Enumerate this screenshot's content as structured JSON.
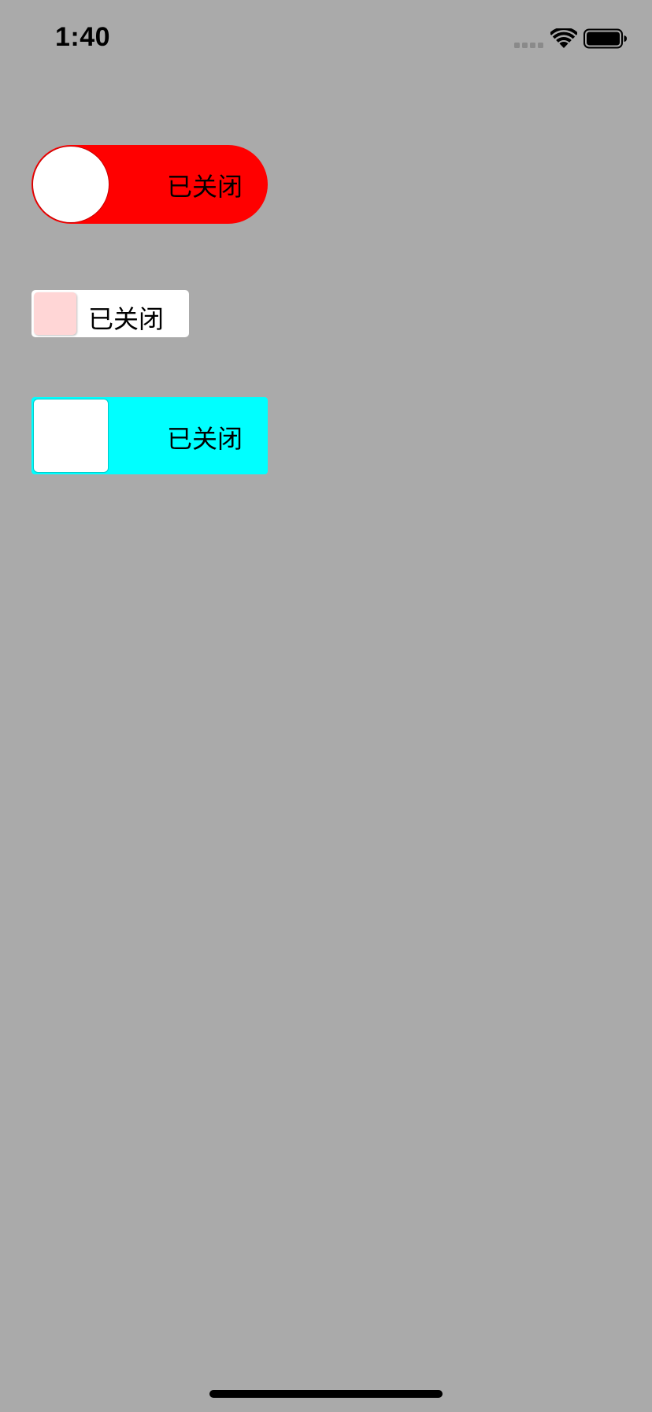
{
  "status_bar": {
    "time": "1:40",
    "icons": [
      "signal-icon",
      "wifi-icon",
      "battery-icon"
    ]
  },
  "toggles": [
    {
      "label": "已关闭",
      "state": "off",
      "track_color": "#ff0000",
      "knob_color": "#ffffff",
      "shape": "pill"
    },
    {
      "label": "已关闭",
      "state": "off",
      "track_color": "#ffffff",
      "knob_color": "#ffd6d6",
      "shape": "rounded-rect"
    },
    {
      "label": "已关闭",
      "state": "off",
      "track_color": "#00ffff",
      "knob_color": "#ffffff",
      "shape": "rounded-rect"
    }
  ],
  "colors": {
    "background": "#aaaaaa",
    "home_indicator": "#000000"
  }
}
